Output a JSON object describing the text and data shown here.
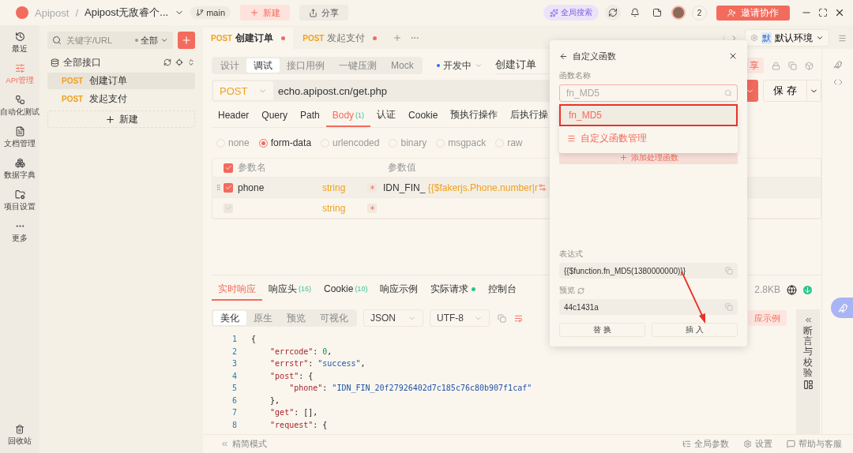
{
  "topbar": {
    "app": "Apipost",
    "separator": "/",
    "project": "Apipost无敌睿个...",
    "branch": "main",
    "new_button": "新建",
    "share_button": "分享",
    "search_button": "全局搜索",
    "member_count": "2",
    "invite_button": "邀请协作"
  },
  "rail": {
    "items": [
      {
        "label": "最近",
        "selected": false
      },
      {
        "label": "API管理",
        "selected": true
      },
      {
        "label": "自动化测试",
        "selected": false
      },
      {
        "label": "文档管理",
        "selected": false
      },
      {
        "label": "数据字典",
        "selected": false
      },
      {
        "label": "项目设置",
        "selected": false
      },
      {
        "label": "更多",
        "selected": false
      }
    ],
    "bottom": "回收站"
  },
  "sidebar": {
    "search": {
      "placeholder": "关键字/URL"
    },
    "filter": "全部",
    "root": "全部接口",
    "items": [
      {
        "method": "POST",
        "name": "创建订单",
        "selected": true
      },
      {
        "method": "POST",
        "name": "发起支付",
        "selected": false
      }
    ],
    "new_button": "新建"
  },
  "tabs": [
    {
      "method": "POST",
      "name": "创建订单",
      "selected": true,
      "unsaved": true
    },
    {
      "method": "POST",
      "name": "发起支付",
      "selected": false,
      "unsaved": true
    }
  ],
  "environment": {
    "badge": "默",
    "name": "默认环境"
  },
  "mode_tabs": [
    {
      "label": "设计",
      "selected": false
    },
    {
      "label": "调试",
      "selected": true
    },
    {
      "label": "接口用例",
      "selected": false
    },
    {
      "label": "一键压测",
      "selected": false
    },
    {
      "label": "Mock",
      "selected": false
    }
  ],
  "status": "开发中",
  "api_name": "创建订单",
  "share_button": "享",
  "url_bar": {
    "method": "POST",
    "url": "echo.apipost.cn/get.php",
    "save_button": "保 存"
  },
  "request_tabs": [
    {
      "label": "Header",
      "selected": false
    },
    {
      "label": "Query",
      "selected": false
    },
    {
      "label": "Path",
      "selected": false
    },
    {
      "label": "Body",
      "count": "(1)",
      "selected": true
    },
    {
      "label": "认证",
      "selected": false
    },
    {
      "label": "Cookie",
      "selected": false
    },
    {
      "label": "预执行操作",
      "selected": false
    },
    {
      "label": "后执行操",
      "selected": false
    }
  ],
  "body_types": [
    {
      "label": "none",
      "selected": false
    },
    {
      "label": "form-data",
      "selected": true
    },
    {
      "label": "urlencoded",
      "selected": false
    },
    {
      "label": "binary",
      "selected": false
    },
    {
      "label": "msgpack",
      "selected": false
    },
    {
      "label": "raw",
      "selected": false
    }
  ],
  "params": {
    "columns": [
      "参数名",
      "参数值"
    ],
    "all_checked": true,
    "rows": [
      {
        "checked": true,
        "name": "phone",
        "type": "string",
        "required": true,
        "value_prefix": "IDN_FIN_",
        "value_expr": "{{$fakerjs.Phone.number|r"
      },
      {
        "checked": false,
        "type": "string",
        "required": true
      }
    ]
  },
  "response": {
    "tabs": [
      {
        "label": "实时响应",
        "selected": true
      },
      {
        "label": "响应头",
        "count": "(16)",
        "selected": false
      },
      {
        "label": "Cookie",
        "count": "(10)",
        "selected": false
      },
      {
        "label": "响应示例",
        "selected": false
      },
      {
        "label": "实际请求",
        "dot": true,
        "selected": false
      },
      {
        "label": "控制台",
        "selected": false
      }
    ],
    "size": "2.8KB",
    "views": [
      {
        "label": "美化",
        "selected": true
      },
      {
        "label": "原生",
        "selected": false
      },
      {
        "label": "预览",
        "selected": false
      },
      {
        "label": "可视化",
        "selected": false
      }
    ],
    "format": "JSON",
    "encoding": "UTF-8",
    "example_button": "应示例",
    "lines": [
      {
        "number": "1",
        "tokens": [
          {
            "kind": "punct",
            "text": "{"
          }
        ]
      },
      {
        "number": "2",
        "tokens": [
          {
            "kind": "key",
            "text": "    \"errcode\""
          },
          {
            "kind": "punct",
            "text": ": "
          },
          {
            "kind": "num",
            "text": "0"
          },
          {
            "kind": "punct",
            "text": ","
          }
        ]
      },
      {
        "number": "3",
        "tokens": [
          {
            "kind": "key",
            "text": "    \"errstr\""
          },
          {
            "kind": "punct",
            "text": ": "
          },
          {
            "kind": "str",
            "text": "\"success\""
          },
          {
            "kind": "punct",
            "text": ","
          }
        ]
      },
      {
        "number": "4",
        "tokens": [
          {
            "kind": "key",
            "text": "    \"post\""
          },
          {
            "kind": "punct",
            "text": ": {"
          }
        ]
      },
      {
        "number": "5",
        "tokens": [
          {
            "kind": "key",
            "text": "        \"phone\""
          },
          {
            "kind": "punct",
            "text": ": "
          },
          {
            "kind": "str",
            "text": "\"IDN_FIN_20f27926402d7c185c76c80b907f1caf\""
          }
        ]
      },
      {
        "number": "6",
        "tokens": [
          {
            "kind": "punct",
            "text": "    },"
          }
        ]
      },
      {
        "number": "7",
        "tokens": [
          {
            "kind": "key",
            "text": "    \"get\""
          },
          {
            "kind": "punct",
            "text": ": [],"
          }
        ]
      },
      {
        "number": "8",
        "tokens": [
          {
            "kind": "key",
            "text": "    \"request\""
          },
          {
            "kind": "punct",
            "text": ": {"
          }
        ]
      }
    ],
    "assert_panel": "断言与校验"
  },
  "footer": {
    "compact": "精简模式",
    "links": [
      "全局参数",
      "设置",
      "帮助与客服"
    ]
  },
  "popup": {
    "title": "自定义函数",
    "name_label": "函数名称",
    "name_field": {
      "placeholder": "fn_MD5"
    },
    "options": [
      {
        "kind": "function",
        "label": "fn_MD5",
        "selected": true,
        "annotated": true
      },
      {
        "kind": "manage",
        "label": "自定义函数管理",
        "selected": false,
        "annotated": false
      }
    ],
    "add_button": "添加处理函数",
    "expression_label": "表达式",
    "expression": "{{$function.fn_MD5(1380000000)}}",
    "preview_label": "预览",
    "preview": "44c1431a",
    "buttons": [
      "替 换",
      "插 入"
    ]
  }
}
